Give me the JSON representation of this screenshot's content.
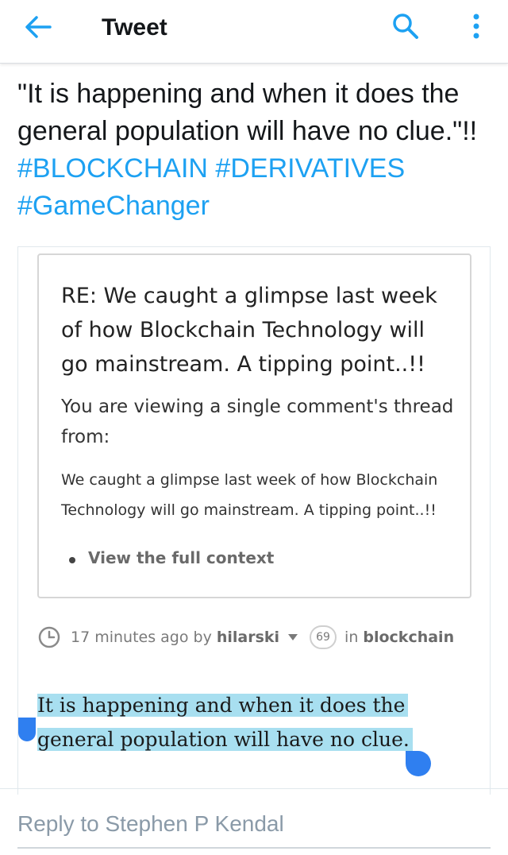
{
  "header": {
    "title": "Tweet",
    "back_icon": "arrow-left-icon",
    "search_icon": "search-icon",
    "more_icon": "more-vertical-icon",
    "accent_color": "#1da1f2"
  },
  "tweet": {
    "text_plain": "\"It is happening and when it does the general population will have no clue.\"!!",
    "hashtags": [
      "#BLOCKCHAIN",
      "#DERIVATIVES",
      "#GameChanger"
    ]
  },
  "card": {
    "re_title": "RE: We caught a glimpse last week of how Blockchain Technology will go mainstream. A tipping point..!!",
    "viewing_text": "You are viewing a single comment's thread from:",
    "parent_post": "We caught a glimpse last week of how Blockchain Technology will go mainstream. A tipping point..!!",
    "full_context_link": "View the full context",
    "meta": {
      "time": "17 minutes ago by",
      "author": "hilarski",
      "reputation": "69",
      "in_label": "in",
      "community": "blockchain"
    },
    "comment_lines": [
      "It is happening and when it does the",
      "general population will have no clue."
    ],
    "selection_color": "#a8dff0"
  },
  "reply": {
    "placeholder": "Reply to Stephen P Kendal",
    "value": ""
  }
}
